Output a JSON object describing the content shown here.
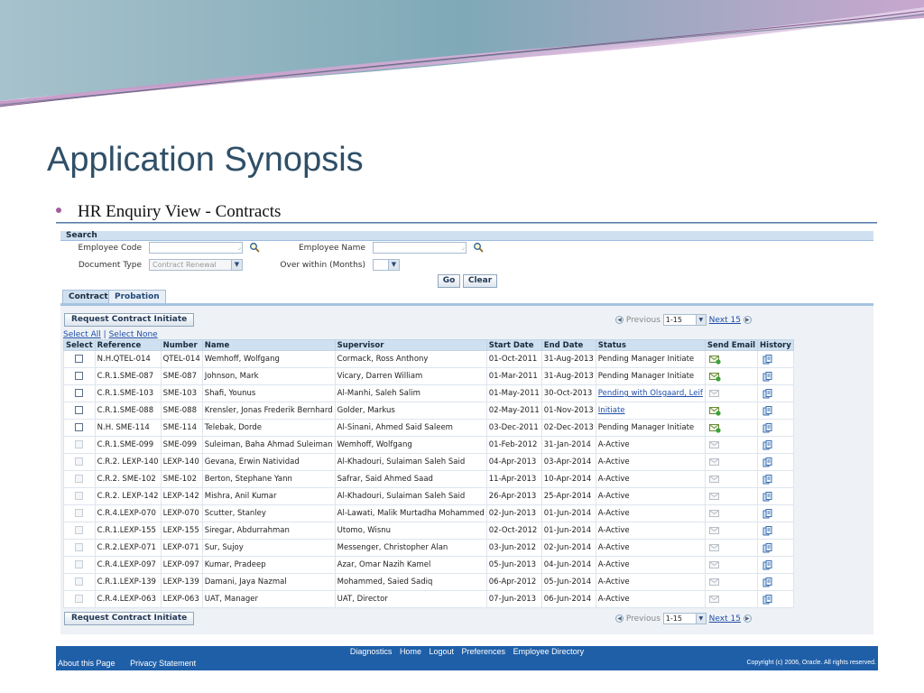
{
  "slide": {
    "title": "Application Synopsis",
    "bullet": "HR  Enquiry View - Contracts"
  },
  "search": {
    "header": "Search",
    "employee_code_label": "Employee Code",
    "employee_name_label": "Employee Name",
    "document_type_label": "Document Type",
    "document_type_value": "Contract Renewal",
    "over_within_label": "Over within (Months)",
    "go_label": "Go",
    "clear_label": "Clear"
  },
  "tabs": [
    {
      "label": "Contract",
      "active": true
    },
    {
      "label": "Probation",
      "active": false
    }
  ],
  "toolbar": {
    "request_label": "Request Contract Initiate",
    "previous_label": "Previous",
    "range_value": "1-15",
    "next_label": "Next 15"
  },
  "select_links": {
    "select_all": "Select All",
    "separator": "|",
    "select_none": "Select None"
  },
  "table": {
    "columns": [
      "Select",
      "Reference",
      "Number",
      "Name",
      "Supervisor",
      "Start Date",
      "End Date",
      "Status",
      "Send Email",
      "History"
    ],
    "rows": [
      {
        "enabled": true,
        "reference": "N.H.QTEL-014",
        "number": "QTEL-014",
        "name": "Wemhoff, Wolfgang",
        "supervisor": "Cormack, Ross Anthony",
        "start": "01-Oct-2011",
        "end": "31-Aug-2013",
        "status": "Pending Manager Initiate",
        "status_link": false,
        "email_active": true
      },
      {
        "enabled": true,
        "reference": "C.R.1.SME-087",
        "number": "SME-087",
        "name": "Johnson, Mark",
        "supervisor": "Vicary, Darren William",
        "start": "01-Mar-2011",
        "end": "31-Aug-2013",
        "status": "Pending Manager Initiate",
        "status_link": false,
        "email_active": true
      },
      {
        "enabled": true,
        "reference": "C.R.1.SME-103",
        "number": "SME-103",
        "name": "Shafi, Younus",
        "supervisor": "Al-Manhi, Saleh Salim",
        "start": "01-May-2011",
        "end": "30-Oct-2013",
        "status": "Pending with Olsgaard, Leif",
        "status_link": true,
        "email_active": false
      },
      {
        "enabled": true,
        "reference": "C.R.1.SME-088",
        "number": "SME-088",
        "name": "Krensler, Jonas Frederik Bernhard",
        "supervisor": "Golder, Markus",
        "start": "02-May-2011",
        "end": "01-Nov-2013",
        "status": "Initiate",
        "status_link": true,
        "email_active": true
      },
      {
        "enabled": true,
        "reference": "N.H. SME-114",
        "number": "SME-114",
        "name": "Telebak, Dorde",
        "supervisor": "Al-Sinani, Ahmed Said Saleem",
        "start": "03-Dec-2011",
        "end": "02-Dec-2013",
        "status": "Pending Manager Initiate",
        "status_link": false,
        "email_active": true
      },
      {
        "enabled": false,
        "reference": "C.R.1.SME-099",
        "number": "SME-099",
        "name": "Suleiman, Baha Ahmad Suleiman",
        "supervisor": "Wemhoff, Wolfgang",
        "start": "01-Feb-2012",
        "end": "31-Jan-2014",
        "status": "A-Active",
        "status_link": false,
        "email_active": false
      },
      {
        "enabled": false,
        "reference": "C.R.2. LEXP-140",
        "number": "LEXP-140",
        "name": "Gevana, Erwin Natividad",
        "supervisor": "Al-Khadouri, Sulaiman Saleh Said",
        "start": "04-Apr-2013",
        "end": "03-Apr-2014",
        "status": "A-Active",
        "status_link": false,
        "email_active": false
      },
      {
        "enabled": false,
        "reference": "C.R.2. SME-102",
        "number": "SME-102",
        "name": "Berton, Stephane Yann",
        "supervisor": "Safrar, Said Ahmed Saad",
        "start": "11-Apr-2013",
        "end": "10-Apr-2014",
        "status": "A-Active",
        "status_link": false,
        "email_active": false
      },
      {
        "enabled": false,
        "reference": "C.R.2. LEXP-142",
        "number": "LEXP-142",
        "name": "Mishra, Anil Kumar",
        "supervisor": "Al-Khadouri, Sulaiman Saleh Said",
        "start": "26-Apr-2013",
        "end": "25-Apr-2014",
        "status": "A-Active",
        "status_link": false,
        "email_active": false
      },
      {
        "enabled": false,
        "reference": "C.R.4.LEXP-070",
        "number": "LEXP-070",
        "name": "Scutter, Stanley",
        "supervisor": "Al-Lawati, Malik Murtadha Mohammed",
        "start": "02-Jun-2013",
        "end": "01-Jun-2014",
        "status": "A-Active",
        "status_link": false,
        "email_active": false
      },
      {
        "enabled": false,
        "reference": "C.R.1.LEXP-155",
        "number": "LEXP-155",
        "name": "Siregar, Abdurrahman",
        "supervisor": "Utomo, Wisnu",
        "start": "02-Oct-2012",
        "end": "01-Jun-2014",
        "status": "A-Active",
        "status_link": false,
        "email_active": false
      },
      {
        "enabled": false,
        "reference": "C.R.2.LEXP-071",
        "number": "LEXP-071",
        "name": "Sur, Sujoy",
        "supervisor": "Messenger, Christopher Alan",
        "start": "03-Jun-2012",
        "end": "02-Jun-2014",
        "status": "A-Active",
        "status_link": false,
        "email_active": false
      },
      {
        "enabled": false,
        "reference": "C.R.4.LEXP-097",
        "number": "LEXP-097",
        "name": "Kumar, Pradeep",
        "supervisor": "Azar, Omar Nazih Kamel",
        "start": "05-Jun-2013",
        "end": "04-Jun-2014",
        "status": "A-Active",
        "status_link": false,
        "email_active": false
      },
      {
        "enabled": false,
        "reference": "C.R.1.LEXP-139",
        "number": "LEXP-139",
        "name": "Damani, Jaya Nazmal",
        "supervisor": "Mohammed, Saied Sadiq",
        "start": "06-Apr-2012",
        "end": "05-Jun-2014",
        "status": "A-Active",
        "status_link": false,
        "email_active": false
      },
      {
        "enabled": false,
        "reference": "C.R.4.LEXP-063",
        "number": "LEXP-063",
        "name": "UAT, Manager",
        "supervisor": "UAT, Director",
        "start": "07-Jun-2013",
        "end": "06-Jun-2014",
        "status": "A-Active",
        "status_link": false,
        "email_active": false
      }
    ]
  },
  "footer": {
    "links": [
      "Diagnostics",
      "Home",
      "Logout",
      "Preferences",
      "Employee Directory"
    ],
    "left_links": [
      "About this Page",
      "Privacy Statement"
    ],
    "copyright": "Copyright (c) 2006, Oracle. All rights reserved."
  },
  "colors": {
    "header_blue": "#cfe0f1",
    "footer_blue": "#1f5fa8",
    "link_blue": "#1f4ea8",
    "title_color": "#2f4f67"
  }
}
